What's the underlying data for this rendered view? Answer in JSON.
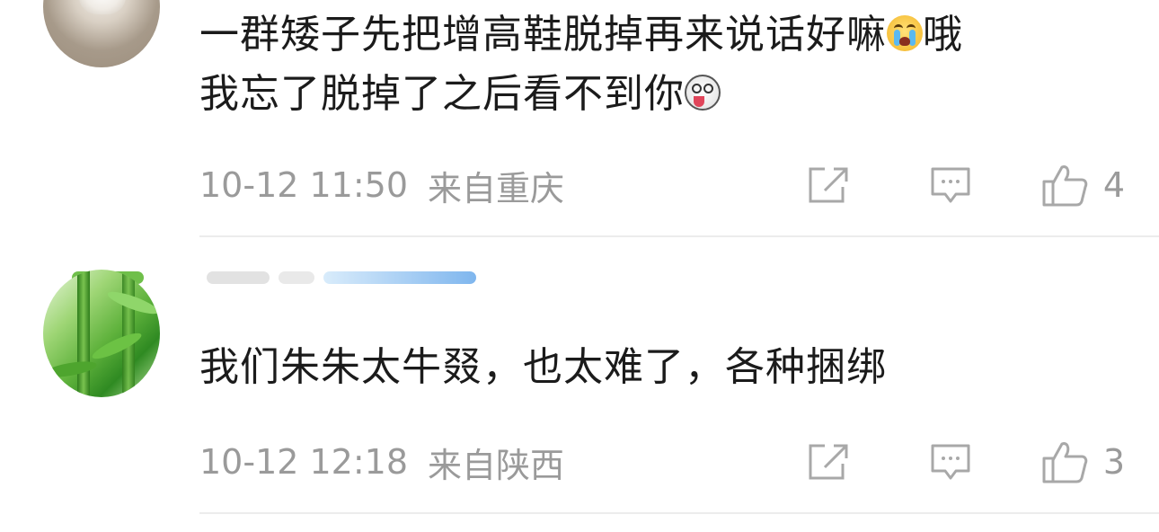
{
  "comments": [
    {
      "avatar": "avatar-plush-toy",
      "text_line1": "一群矮子先把增高鞋脱掉再来说话好嘛",
      "emoji1": "crying-face-emoji",
      "text_line1_end": "哦",
      "text_line2": "我忘了脱掉了之后看不到你",
      "emoji2": "dizzy-face-emoji",
      "time": "10-12 11:50",
      "location": "来自重庆",
      "likes": "4"
    },
    {
      "avatar": "avatar-bamboo",
      "text": "我们朱朱太牛叕，也太难了，各种捆绑",
      "time": "10-12 12:18",
      "location": "来自陕西",
      "likes": "3"
    }
  ],
  "icons": {
    "share": "share-icon",
    "comment": "comment-icon",
    "like": "thumbs-up-icon"
  },
  "colors": {
    "text": "#1b1b1b",
    "meta": "#9a9a9a",
    "divider": "#ececec"
  }
}
